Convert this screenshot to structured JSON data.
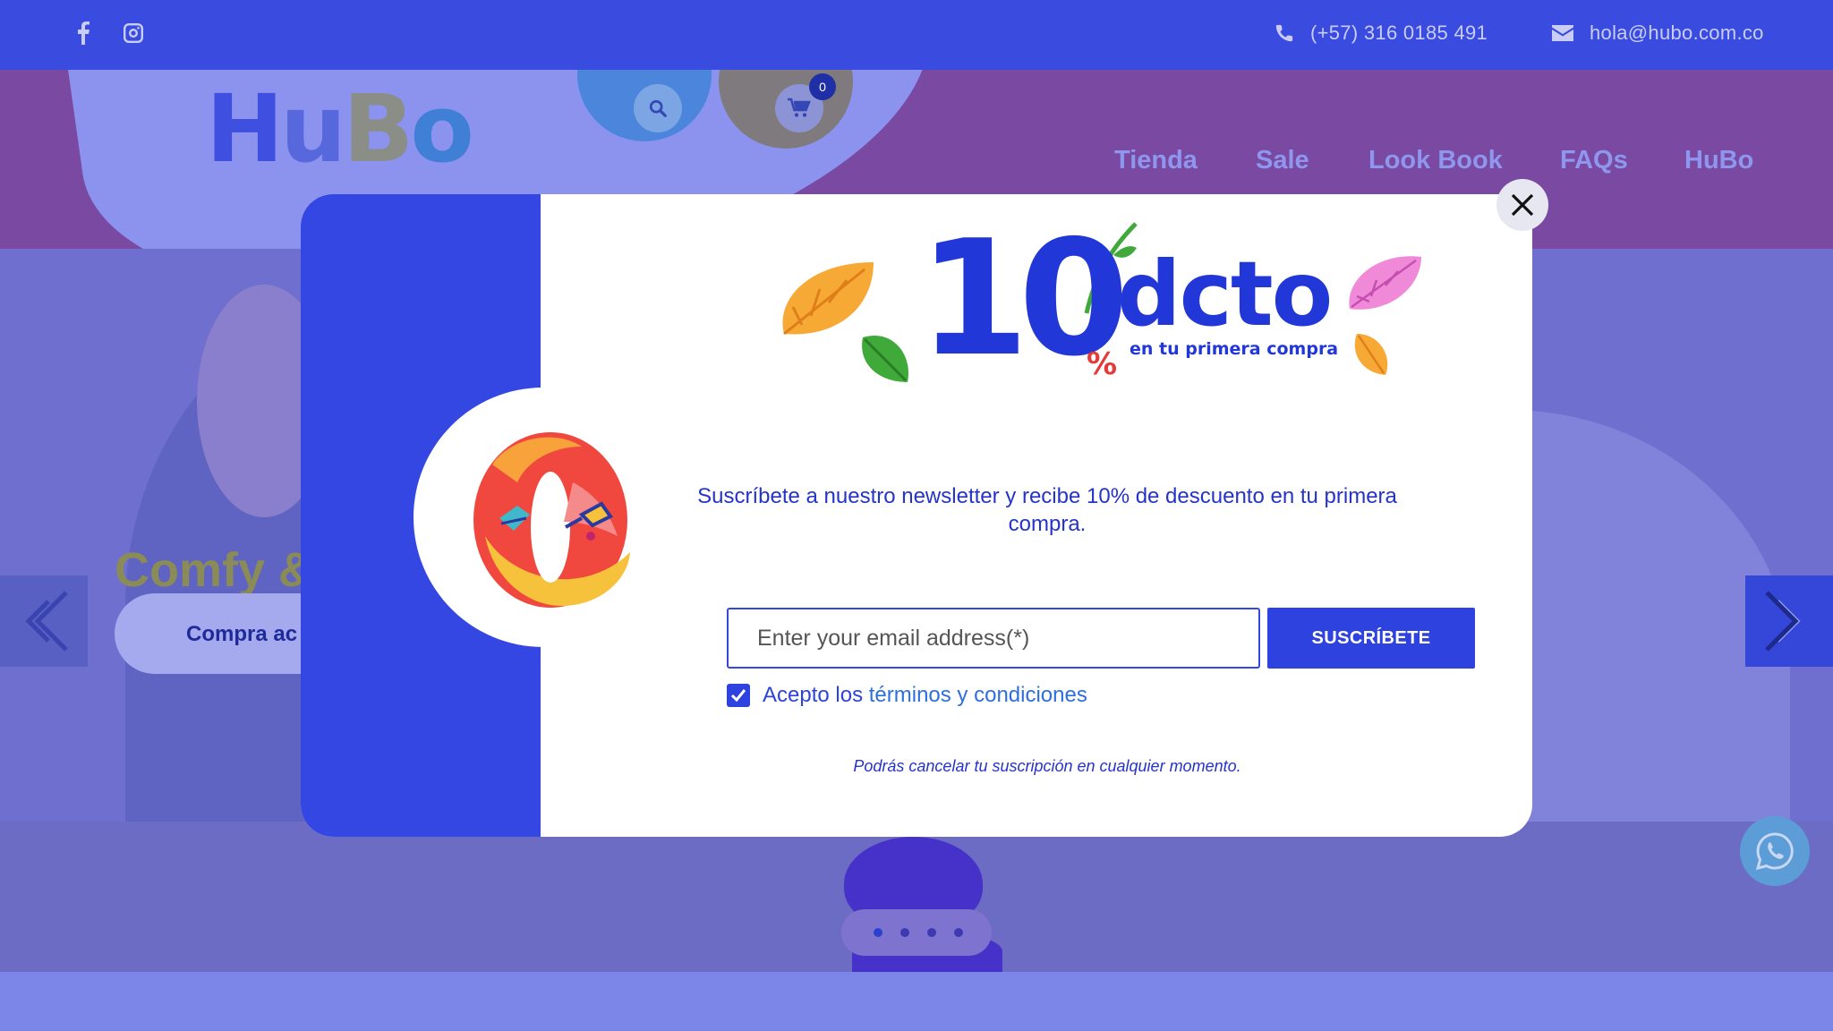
{
  "topbar": {
    "social": [
      "facebook-icon",
      "instagram-icon"
    ],
    "phone": "(+57) 316 0185 491",
    "email": "hola@hubo.com.co"
  },
  "header": {
    "logo": {
      "p1": "H",
      "p2": "u",
      "p3": "B",
      "p4": "o"
    },
    "cart_count": "0",
    "nav": [
      "Tienda",
      "Sale",
      "Look Book",
      "FAQs",
      "HuBo"
    ]
  },
  "hero": {
    "title": "Comfy & co",
    "cta_label": "Compra ac",
    "slides_total": 4,
    "slide_active": 1
  },
  "modal": {
    "promo_number": "10",
    "promo_percent": "%",
    "promo_word": "dcto",
    "promo_sub": "en tu primera compra",
    "description": "Suscríbete a nuestro newsletter y recibe 10% de descuento en tu primera compra.",
    "email_placeholder": "Enter your email address(*)",
    "subscribe_label": "SUSCRÍBETE",
    "terms_prefix": "Acepto los ",
    "terms_link": "términos y condiciones",
    "terms_checked": true,
    "cancel_note": "Podrás cancelar tu suscripción en cualquier momento."
  },
  "colors": {
    "brand_blue": "#3547e2",
    "topbar": "#3a4be0",
    "header_dimmed": "#7a4aa2",
    "accent_red": "#e53a3a"
  }
}
